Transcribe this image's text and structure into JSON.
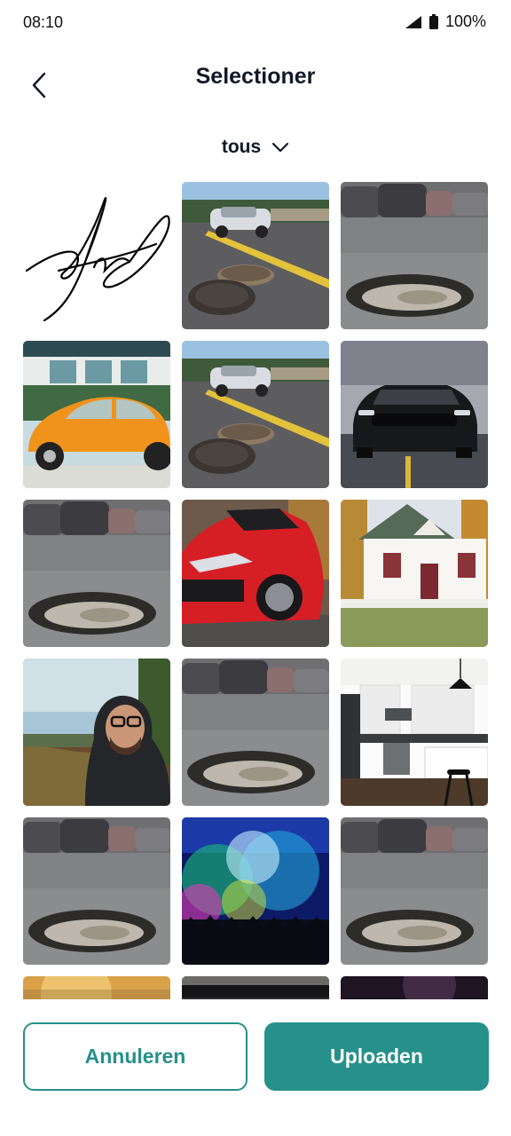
{
  "status_bar": {
    "time": "08:10",
    "battery": "100%"
  },
  "header": {
    "title": "Selectioner"
  },
  "filter": {
    "label": "tous"
  },
  "gallery": {
    "items": [
      {
        "kind": "signature"
      },
      {
        "kind": "road-car"
      },
      {
        "kind": "pothole"
      },
      {
        "kind": "orange-beetle"
      },
      {
        "kind": "road-car"
      },
      {
        "kind": "black-mustang"
      },
      {
        "kind": "pothole"
      },
      {
        "kind": "red-car"
      },
      {
        "kind": "white-house"
      },
      {
        "kind": "selfie-man"
      },
      {
        "kind": "pothole"
      },
      {
        "kind": "kitchen"
      },
      {
        "kind": "pothole"
      },
      {
        "kind": "concert"
      },
      {
        "kind": "pothole"
      },
      {
        "kind": "warm-blur"
      },
      {
        "kind": "dark-crowd"
      },
      {
        "kind": "purple-dark"
      }
    ]
  },
  "actions": {
    "cancel_label": "Annuleren",
    "upload_label": "Uploaden"
  },
  "colors": {
    "accent": "#25918a",
    "title": "#111827"
  }
}
